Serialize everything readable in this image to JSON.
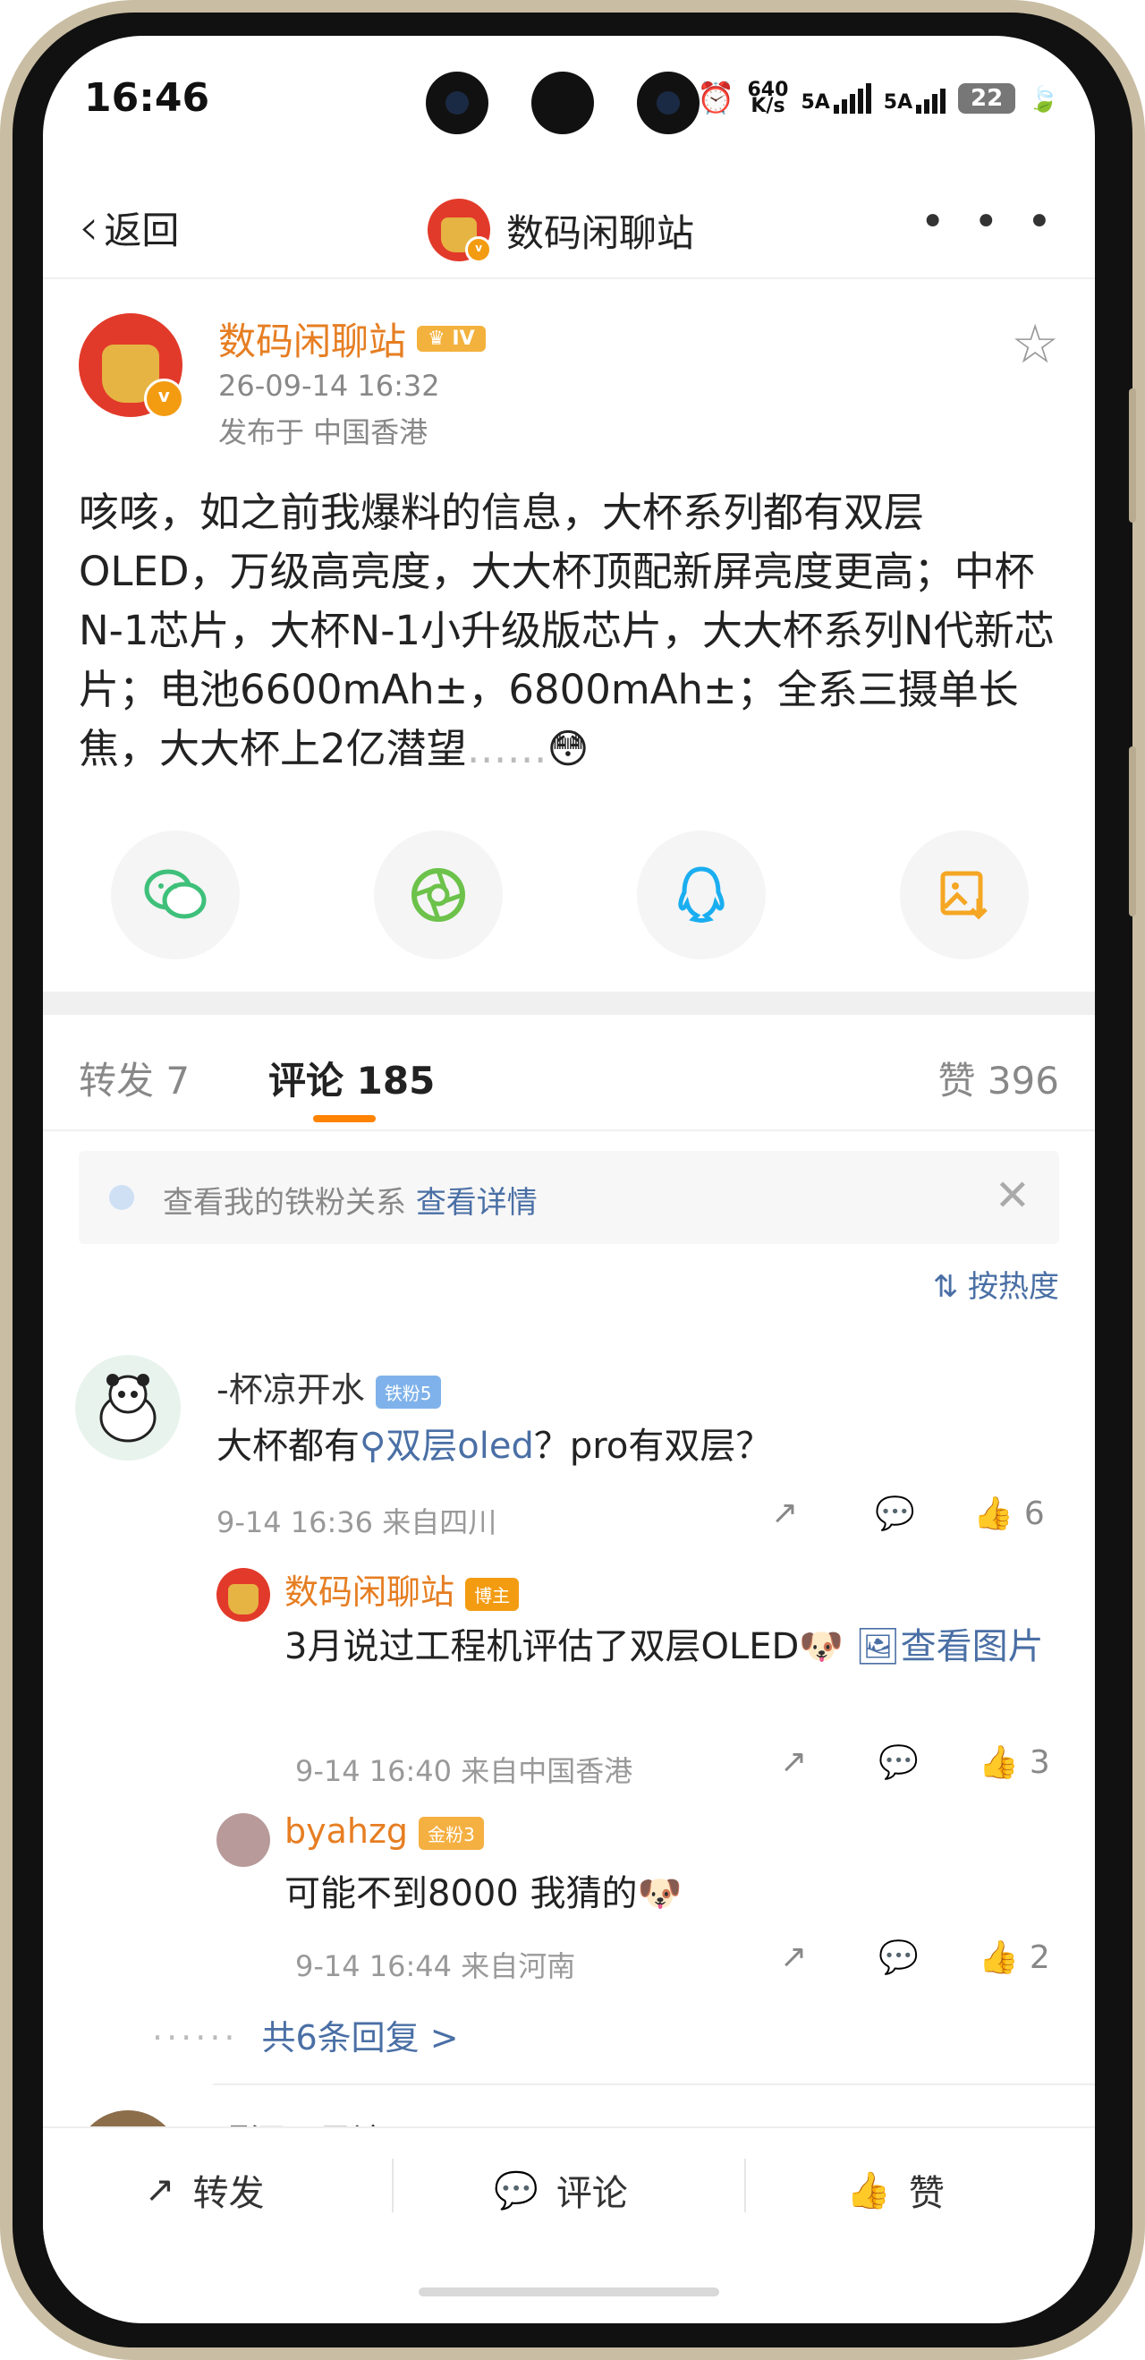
{
  "status_bar": {
    "time": "16:46",
    "net_speed_value": "640",
    "net_speed_unit": "K/s",
    "sig1_label": "5A",
    "sig2_label": "5A",
    "battery": "22"
  },
  "nav": {
    "back_label": "返回",
    "title": "数码闲聊站",
    "more_label": "• • •"
  },
  "post": {
    "author": "数码闲聊站",
    "level_badge": "IV",
    "time": "26-09-14 16:32",
    "location": "发布于 中国香港",
    "text": "咳咳，如之前我爆料的信息，大杯系列都有双层OLED，万级高亮度，大大杯顶配新屏亮度更高；中杯N-1芯片，大杯N-1小升级版芯片，大大杯系列N代新芯片；电池6600mAh±，6800mAh±；全系三摄单长焦，大大杯上2亿潜望",
    "text_tail": "……"
  },
  "share_targets": [
    "wechat-icon",
    "moments-icon",
    "qq-icon",
    "save-image-icon"
  ],
  "tabs": {
    "repost": "转发 7",
    "comments": "评论 185",
    "likes": "赞 396"
  },
  "notice": {
    "text": "查看我的铁粉关系 ",
    "link": "查看详情",
    "close": "✕"
  },
  "sort": {
    "label": "按热度",
    "icon": "⇅"
  },
  "comments": [
    {
      "user": "-杯凉开水",
      "badge": "铁粉5",
      "text_prefix": "大杯都有",
      "text_link": "双层oled",
      "text_suffix": "？pro有双层？",
      "meta": "9-14 16:36 来自四川",
      "likes": "6"
    }
  ],
  "replies": [
    {
      "user": "数码闲聊站",
      "badge": "博主",
      "text": "3月说过工程机评估了双层OLED",
      "emoji": "🐶",
      "image_link": "查看图片",
      "meta": "9-14 16:40 来自中国香港",
      "likes": "3"
    },
    {
      "user": "byahzg",
      "badge": "金粉3",
      "text": "可能不到8000 我猜的",
      "emoji": "🐶",
      "meta": "9-14 16:44 来自河南",
      "likes": "2"
    }
  ],
  "more_replies": "共6条回复 >",
  "next_comment_user": "喝酒不风流",
  "bottom_bar": {
    "repost": "转发",
    "comment": "评论",
    "like": "赞"
  },
  "colors": {
    "accent_orange": "#ff8200",
    "link_blue": "#4a6fa5",
    "name_orange": "#e67e22"
  }
}
